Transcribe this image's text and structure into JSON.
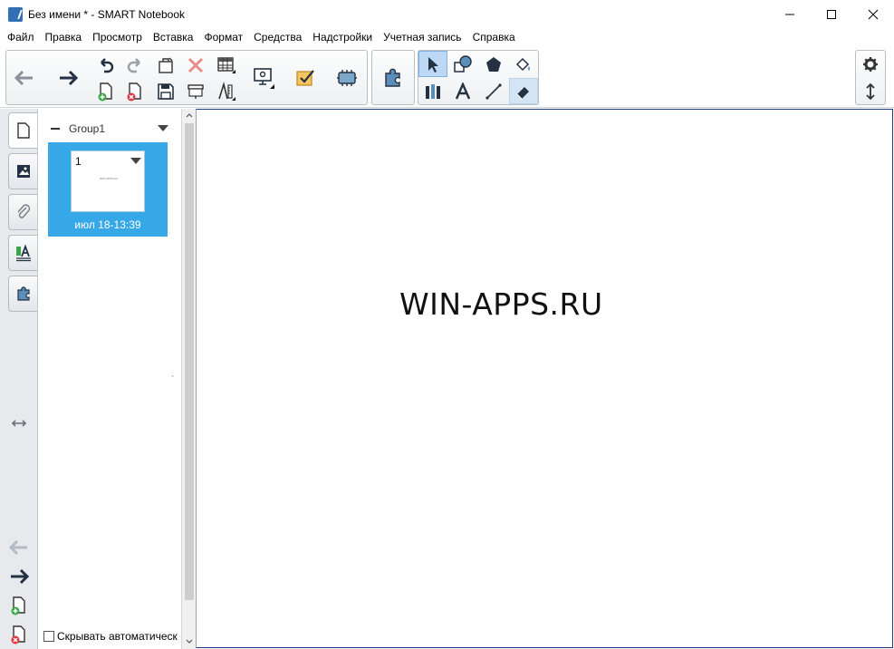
{
  "window": {
    "title": "Без имени * - SMART Notebook",
    "controls": [
      "minimize",
      "maximize",
      "close"
    ]
  },
  "menu": {
    "items": [
      "Файл",
      "Правка",
      "Просмотр",
      "Вставка",
      "Формат",
      "Средства",
      "Надстройки",
      "Учетная запись",
      "Справка"
    ]
  },
  "toolbar": {
    "icons": {
      "back": "arrow-left-icon",
      "forward": "arrow-right-icon",
      "undo": "undo-icon",
      "redo": "redo-icon",
      "add_page": "add-page-icon",
      "delete_page": "delete-page-icon",
      "paste": "paste-icon",
      "save": "save-icon",
      "delete": "delete-x-icon",
      "screen_shade": "screen-shade-icon",
      "table": "table-icon",
      "measure": "measurement-tools-icon",
      "display": "display-icon",
      "response": "response-icon",
      "widgets": "widgets-icon",
      "addons": "puzzle-icon",
      "select": "select-arrow-icon",
      "shapes": "shapes-icon",
      "polygon": "polygon-icon",
      "fill": "fill-icon",
      "pens": "pens-icon",
      "text": "text-icon",
      "line": "line-icon",
      "eraser": "eraser-icon",
      "settings": "gear-icon",
      "move_toolbar": "move-toolbar-icon"
    }
  },
  "sidebar": {
    "tabs": [
      "page-sorter",
      "gallery",
      "attachments",
      "properties",
      "addons"
    ],
    "group_label": "Group1",
    "page": {
      "number": "1",
      "thumbnail_text": "WIN-APPS.RU",
      "date": "июл 18-13:39"
    },
    "autohide_label": "Скрывать автоматическ"
  },
  "canvas": {
    "text": "WIN-APPS.RU"
  },
  "colors": {
    "selected_page_bg": "#36a8e8",
    "toolbar_selected": "#bcd8f4",
    "canvas_border": "#1e3a8a"
  }
}
